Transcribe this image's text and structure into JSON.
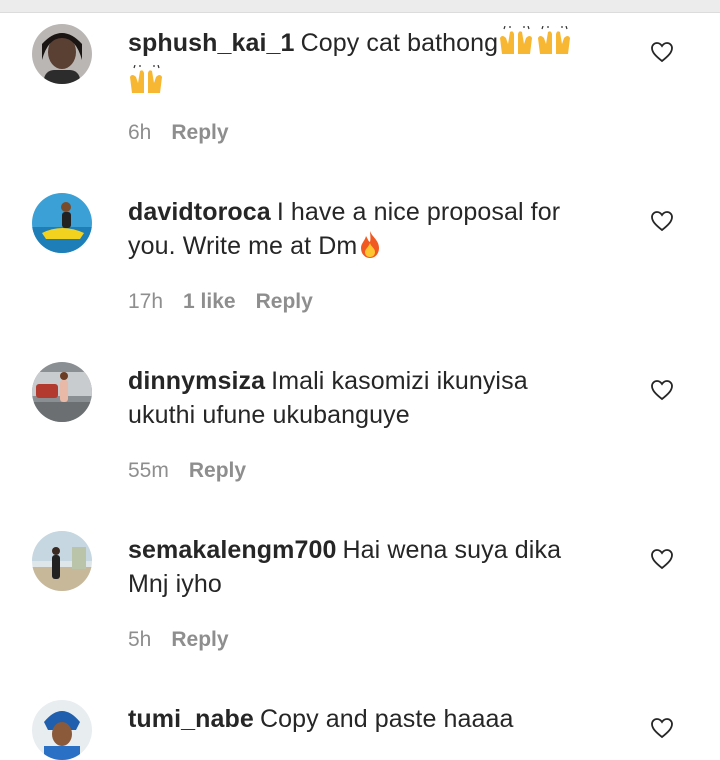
{
  "comments": [
    {
      "username": "sphush_kai_1",
      "text_line1": "Copy cat bathong",
      "text_line2": "",
      "time": "6h",
      "likes": "",
      "reply": "Reply",
      "emojis": [
        "raising-hands",
        "raising-hands",
        "raising-hands"
      ]
    },
    {
      "username": "davidtoroca",
      "text_line1": "I have a nice proposal for",
      "text_line2": "you. Write me at Dm",
      "time": "17h",
      "likes": "1 like",
      "reply": "Reply",
      "emojis": [
        "fire"
      ]
    },
    {
      "username": "dinnymsiza",
      "text_line1": "Imali kasomizi ikunyisa",
      "text_line2": "ukuthi ufune ukubanguye",
      "time": "55m",
      "likes": "",
      "reply": "Reply",
      "emojis": []
    },
    {
      "username": "semakalengm700",
      "text_line1": "Hai wena suya dika",
      "text_line2": "Mnj iyho",
      "time": "5h",
      "likes": "",
      "reply": "Reply",
      "emojis": []
    },
    {
      "username": "tumi_nabe",
      "text_line1": "Copy and paste haaaa",
      "text_line2": "",
      "time": "",
      "likes": "",
      "reply": "",
      "emojis": []
    }
  ]
}
